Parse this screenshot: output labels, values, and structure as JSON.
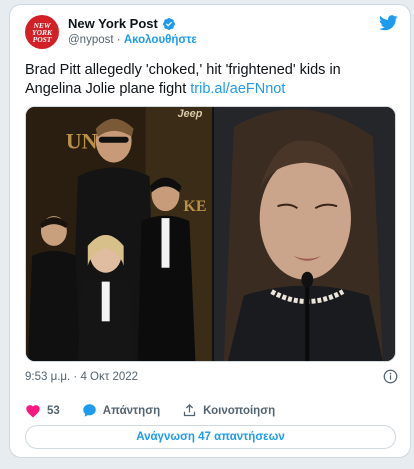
{
  "account": {
    "avatar_text": [
      "NEW",
      "YORK",
      "POST"
    ],
    "display_name": "New York Post",
    "handle": "@nypost",
    "separator": "·",
    "follow_label": "Ακολουθήστε"
  },
  "tweet": {
    "text": "Brad Pitt allegedly 'choked,' hit 'frightened' kids in Angelina Jolie plane fight",
    "link": "trib.al/aeFNnot",
    "timestamp": "9:53 μ.μ. · 4 Οκτ 2022"
  },
  "media": {
    "left_backdrop_text": "UNB",
    "left_sign_text": "Jeep",
    "left_edge_text": "KE"
  },
  "actions": {
    "likes_count": "53",
    "reply_label": "Απάντηση",
    "share_label": "Κοινοποίηση"
  },
  "replies_button_label": "Ανάγνωση 47 απαντήσεων",
  "colors": {
    "accent": "#1d9bf0",
    "like": "#f91880",
    "brand_red": "#d32027",
    "text_secondary": "#536471",
    "border": "#cfd9de",
    "background": "#e6ecf0"
  }
}
